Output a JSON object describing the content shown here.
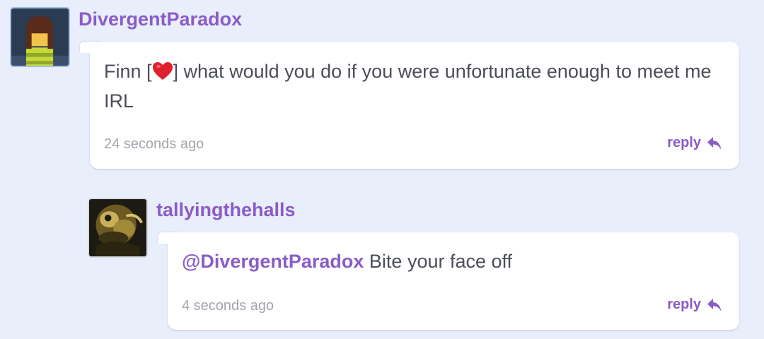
{
  "comments": [
    {
      "username": "DivergentParadox",
      "text_before_emoji": "Finn [",
      "emoji": "red-heart",
      "text_after_emoji": "] what would you do if you were unfortunate enough to meet me IRL",
      "timestamp": "24 seconds ago",
      "reply_label": "reply"
    },
    {
      "username": "tallyingthehalls",
      "mention": "@DivergentParadox",
      "text": " Bite your face off",
      "timestamp": "4 seconds ago",
      "reply_label": "reply"
    }
  ],
  "colors": {
    "background": "#e8eefa",
    "accent": "#8a5cc7",
    "text": "#4b4e58",
    "muted": "#a3a5ac"
  },
  "icons": [
    "red-heart-emoji",
    "reply-arrow-icon"
  ]
}
